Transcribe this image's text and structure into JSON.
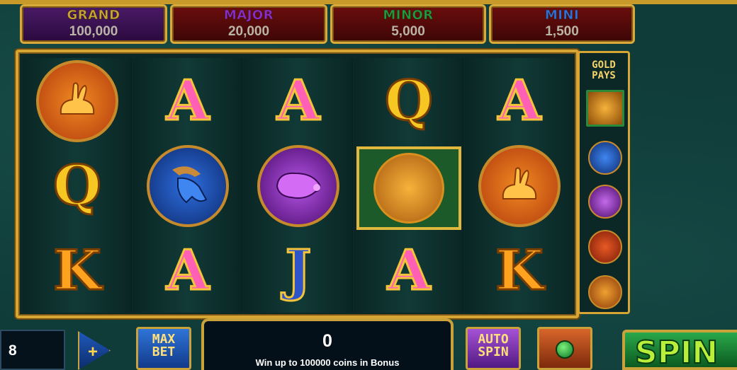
{
  "jackpots": [
    {
      "label": "GRAND",
      "value": "100,000",
      "color": "#c8a436"
    },
    {
      "label": "MAJOR",
      "value": "20,000",
      "color": "#8b2ad0"
    },
    {
      "label": "MINOR",
      "value": "5,000",
      "color": "#1f9a3e"
    },
    {
      "label": "MINI",
      "value": "1,500",
      "color": "#2f6fe0"
    }
  ],
  "reels": [
    [
      "rabbit",
      "Q",
      "K"
    ],
    [
      "A",
      "goat",
      "A"
    ],
    [
      "A",
      "pig",
      "J"
    ],
    [
      "Q",
      "tiger",
      "A"
    ],
    [
      "A",
      "rabbit",
      "K"
    ]
  ],
  "gold_pays": {
    "title_line1": "GOLD",
    "title_line2": "PAYS",
    "icons": [
      "tiger-icon",
      "goat-icon",
      "pig-icon",
      "rooster-icon",
      "rabbit-icon"
    ]
  },
  "bet": {
    "value": "8",
    "plus": "+"
  },
  "buttons": {
    "max_bet_line1": "MAX",
    "max_bet_line2": "BET",
    "auto_spin_line1": "AUTO",
    "auto_spin_line2": "SPIN",
    "spin": "SPIN"
  },
  "win": {
    "value": "0",
    "message": "Win up to 100000 coins in Bonus"
  }
}
